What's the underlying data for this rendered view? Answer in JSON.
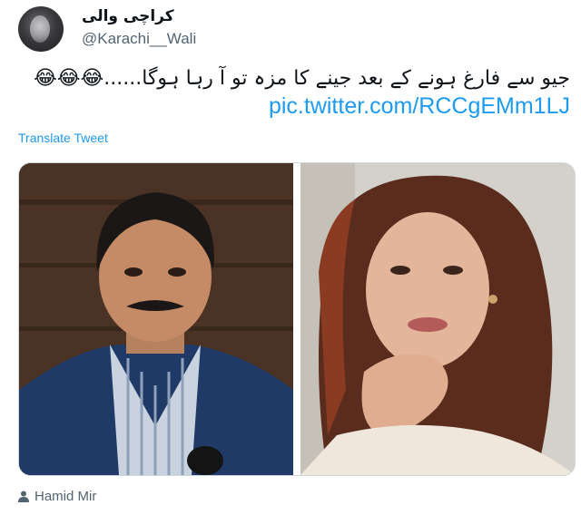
{
  "tweet": {
    "display_name": "كراچی والی",
    "handle": "@Karachi__Wali",
    "text": "جیو سے فارغ ہونے کے بعد جینے کا مزہ تو آ رہا ہوگا......",
    "emojis": "😂😂😂",
    "link": "pic.twitter.com/RCCgEMm1LJ",
    "translate_label": "Translate Tweet",
    "tagged_person": "Hamid Mir"
  },
  "colors": {
    "link": "#1d9bf0",
    "secondary_text": "#536471",
    "border": "#cfd9de"
  },
  "icons": {
    "tag": "person-icon"
  }
}
